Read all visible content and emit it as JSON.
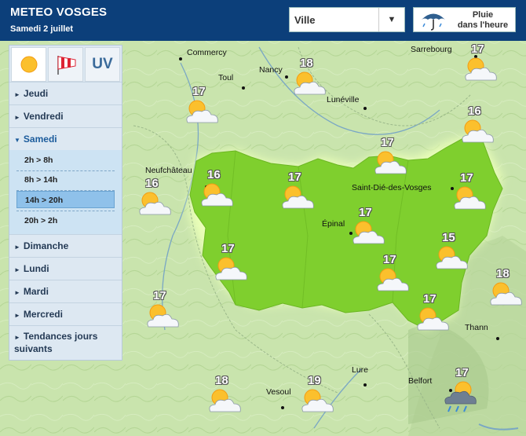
{
  "header": {
    "title": "METEO VOSGES",
    "date": "Samedi 2 juillet"
  },
  "city_select": {
    "value": "Ville",
    "arrow": "▼"
  },
  "rain_button": {
    "label_line1": "Pluie",
    "label_line2": "dans l'heure",
    "icon": "umbrella-icon"
  },
  "tabs": [
    {
      "name": "sun-icon",
      "active": true
    },
    {
      "name": "windsock-icon",
      "active": false
    },
    {
      "label": "UV",
      "active": false
    }
  ],
  "days": [
    "Jeudi",
    "Vendredi",
    "Samedi",
    "Dimanche",
    "Lundi",
    "Mardi",
    "Mercredi",
    "Tendances jours suivants"
  ],
  "day_open": "Samedi",
  "slots": [
    {
      "label": "2h > 8h",
      "selected": false
    },
    {
      "label": "8h > 14h",
      "selected": false
    },
    {
      "label": "14h > 20h",
      "selected": true
    },
    {
      "label": "20h > 2h",
      "selected": false
    }
  ],
  "places": [
    "Commercy",
    "Sarrebourg",
    "Nancy",
    "Toul",
    "Lunéville",
    "Neufchâteau",
    "Saint-Dié-des-Vosges",
    "Épinal",
    "Thann",
    "Lure",
    "Belfort",
    "Vesoul"
  ],
  "forecasts": [
    {
      "temp": "18",
      "icon": "sun-cloud"
    },
    {
      "temp": "17",
      "icon": "sun-cloud"
    },
    {
      "temp": "17",
      "icon": "sun-cloud"
    },
    {
      "temp": "16",
      "icon": "sun-cloud"
    },
    {
      "temp": "17",
      "icon": "sun-cloud"
    },
    {
      "temp": "16",
      "icon": "sun-cloud"
    },
    {
      "temp": "16",
      "icon": "sun-cloud"
    },
    {
      "temp": "17",
      "icon": "sun-cloud"
    },
    {
      "temp": "17",
      "icon": "sun-cloud"
    },
    {
      "temp": "17",
      "icon": "sun-cloud"
    },
    {
      "temp": "17",
      "icon": "sun-cloud"
    },
    {
      "temp": "15",
      "icon": "sun-cloud"
    },
    {
      "temp": "17",
      "icon": "sun-cloud"
    },
    {
      "temp": "18",
      "icon": "sun-cloud"
    },
    {
      "temp": "17",
      "icon": "sun-cloud"
    },
    {
      "temp": "17",
      "icon": "sun-cloud"
    },
    {
      "temp": "18",
      "icon": "sun-cloud"
    },
    {
      "temp": "19",
      "icon": "sun-cloud"
    },
    {
      "temp": "17",
      "icon": "sun-rain-cloud"
    }
  ],
  "colors": {
    "header": "#0c3f7a",
    "region": "#7fcf2e",
    "terrain": "#c7e3aa",
    "panel": "#dde8f2",
    "selected_slot": "#8fc1ea"
  }
}
